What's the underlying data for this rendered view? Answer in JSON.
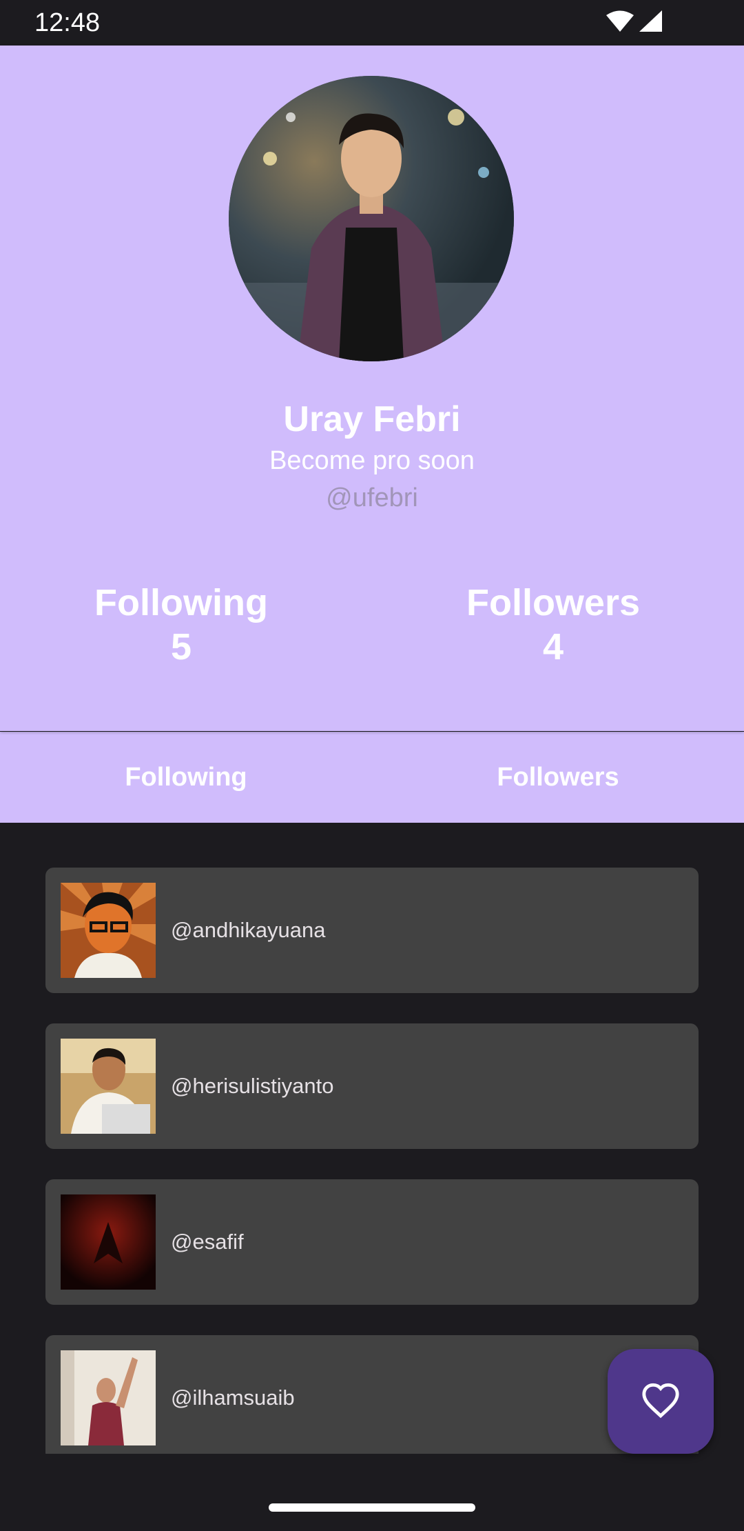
{
  "status_bar": {
    "time": "12:48",
    "icons": [
      "wifi-icon",
      "signal-icon"
    ]
  },
  "profile": {
    "name": "Uray Febri",
    "bio": "Become pro soon",
    "handle": "@ufebri",
    "stats": {
      "following_label": "Following",
      "following_count": "5",
      "followers_label": "Followers",
      "followers_count": "4"
    }
  },
  "tabs": [
    {
      "label": "Following",
      "selected": true
    },
    {
      "label": "Followers",
      "selected": false
    }
  ],
  "users": [
    {
      "username": "@andhikayuana"
    },
    {
      "username": "@herisulistiyanto"
    },
    {
      "username": "@esafif"
    },
    {
      "username": "@ilhamsuaib"
    }
  ],
  "fab": {
    "icon": "heart-outline-icon"
  },
  "colors": {
    "header_bg": "#d0bcfc",
    "page_bg": "#1c1b1f",
    "card_bg": "#424242",
    "fab_bg": "#4f378b",
    "handle_text": "#a195b8"
  }
}
